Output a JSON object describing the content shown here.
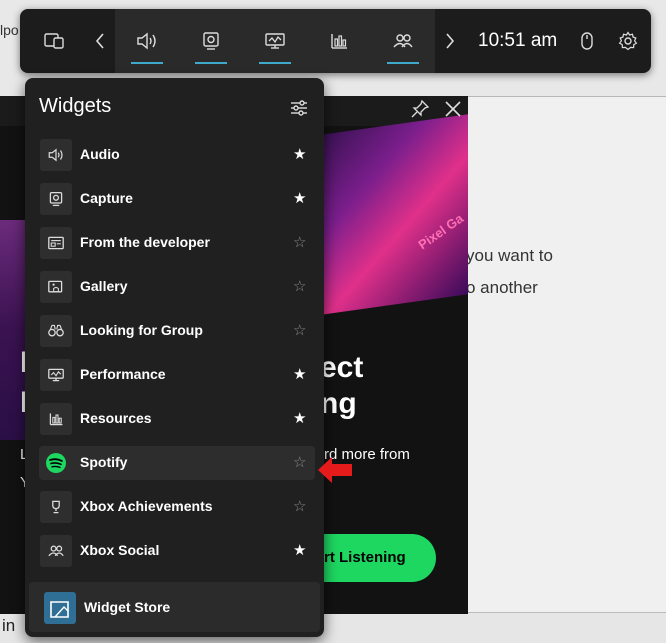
{
  "background": {
    "crumb": "lpo",
    "text_line1": "you want to",
    "text_line2": "o another",
    "bottom_text": "in"
  },
  "spotify_widget": {
    "art_label": "Pixel Ga",
    "headline_line1": "ect",
    "headline_line2": "ng",
    "subtext": "rd more from",
    "left_fragment_1": "I",
    "left_fragment_2": "I",
    "left_fragment_3": "L",
    "left_fragment_4": "Y",
    "cta_label": "rt Listening",
    "accent": "#1ed760"
  },
  "gamebar": {
    "time": "10:51 am",
    "buttons": [
      {
        "icon": "widget-menu-icon"
      },
      {
        "icon": "chevron-left-icon"
      },
      {
        "icon": "audio-icon"
      },
      {
        "icon": "capture-icon"
      },
      {
        "icon": "performance-icon"
      },
      {
        "icon": "resources-icon"
      },
      {
        "icon": "xbox-social-icon"
      },
      {
        "icon": "chevron-right-icon"
      },
      {
        "icon": "mouse-icon"
      },
      {
        "icon": "settings-icon"
      }
    ],
    "accent": "#3fa9c9"
  },
  "widgets_menu": {
    "title": "Widgets",
    "items": [
      {
        "label": "Audio",
        "icon": "speaker-icon",
        "favorite": true
      },
      {
        "label": "Capture",
        "icon": "capture-icon",
        "favorite": true
      },
      {
        "label": "From the developer",
        "icon": "developer-icon",
        "favorite": false
      },
      {
        "label": "Gallery",
        "icon": "gallery-icon",
        "favorite": false
      },
      {
        "label": "Looking for Group",
        "icon": "binoculars-icon",
        "favorite": false
      },
      {
        "label": "Performance",
        "icon": "performance-icon",
        "favorite": true
      },
      {
        "label": "Resources",
        "icon": "resources-icon",
        "favorite": true
      },
      {
        "label": "Spotify",
        "icon": "spotify-icon",
        "favorite": false
      },
      {
        "label": "Xbox Achievements",
        "icon": "trophy-icon",
        "favorite": false
      },
      {
        "label": "Xbox Social",
        "icon": "people-icon",
        "favorite": true
      }
    ],
    "store_label": "Widget Store",
    "star_on": "★",
    "star_off": "☆"
  }
}
